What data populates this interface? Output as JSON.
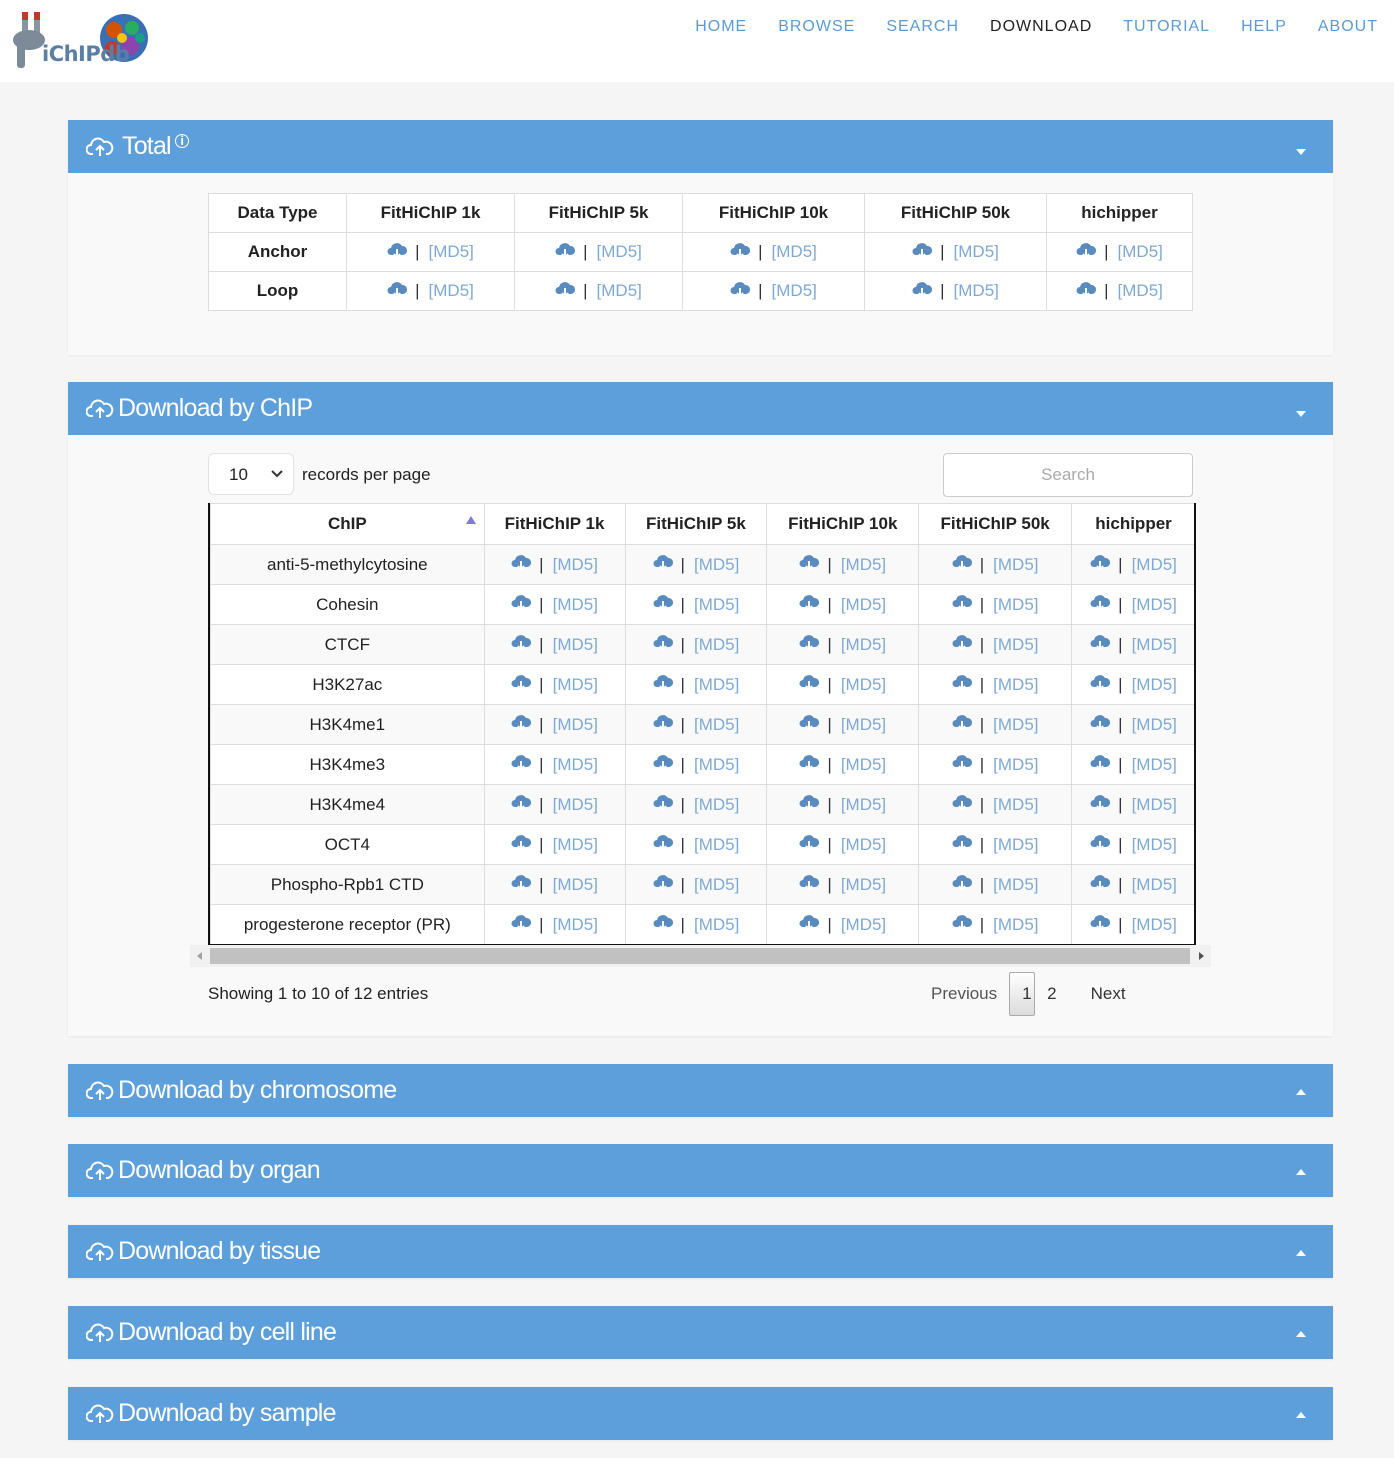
{
  "brand": {
    "logo_text": "iChIPdb"
  },
  "nav": {
    "items": [
      "HOME",
      "BROWSE",
      "SEARCH",
      "DOWNLOAD",
      "TUTORIAL",
      "HELP",
      "ABOUT"
    ],
    "active": "DOWNLOAD"
  },
  "total_panel": {
    "title": "Total",
    "columns": [
      "Data Type",
      "FitHiChIP 1k",
      "FitHiChIP 5k",
      "FitHiChIP 10k",
      "FitHiChIP 50k",
      "hichipper"
    ],
    "rows": [
      "Anchor",
      "Loop"
    ],
    "md5_label": "[MD5]",
    "separator": "|"
  },
  "chip_panel": {
    "title": "Download by ChIP",
    "page_length": "10",
    "records_label": "records per page",
    "search_placeholder": "Search",
    "columns": [
      "ChIP",
      "FitHiChIP 1k",
      "FitHiChIP 5k",
      "FitHiChIP 10k",
      "FitHiChIP 50k",
      "hichipper"
    ],
    "rows": [
      "anti-5-methylcytosine",
      "Cohesin",
      "CTCF",
      "H3K27ac",
      "H3K4me1",
      "H3K4me3",
      "H3K4me4",
      "OCT4",
      "Phospho-Rpb1 CTD",
      "progesterone receptor (PR)"
    ],
    "md5_label": "[MD5]",
    "separator": "|",
    "info": "Showing 1 to 10 of 12 entries",
    "pager": {
      "previous": "Previous",
      "pages": [
        "1",
        "2"
      ],
      "current": "1",
      "next": "Next"
    }
  },
  "collapsed_panels": [
    "Download by chromosome",
    "Download by organ",
    "Download by tissue",
    "Download by cell line",
    "Download by sample"
  ],
  "colors": {
    "panel_header": "#5d9fdb",
    "nav_link": "#5b9bd5",
    "md5_link": "#7ea9d6"
  }
}
